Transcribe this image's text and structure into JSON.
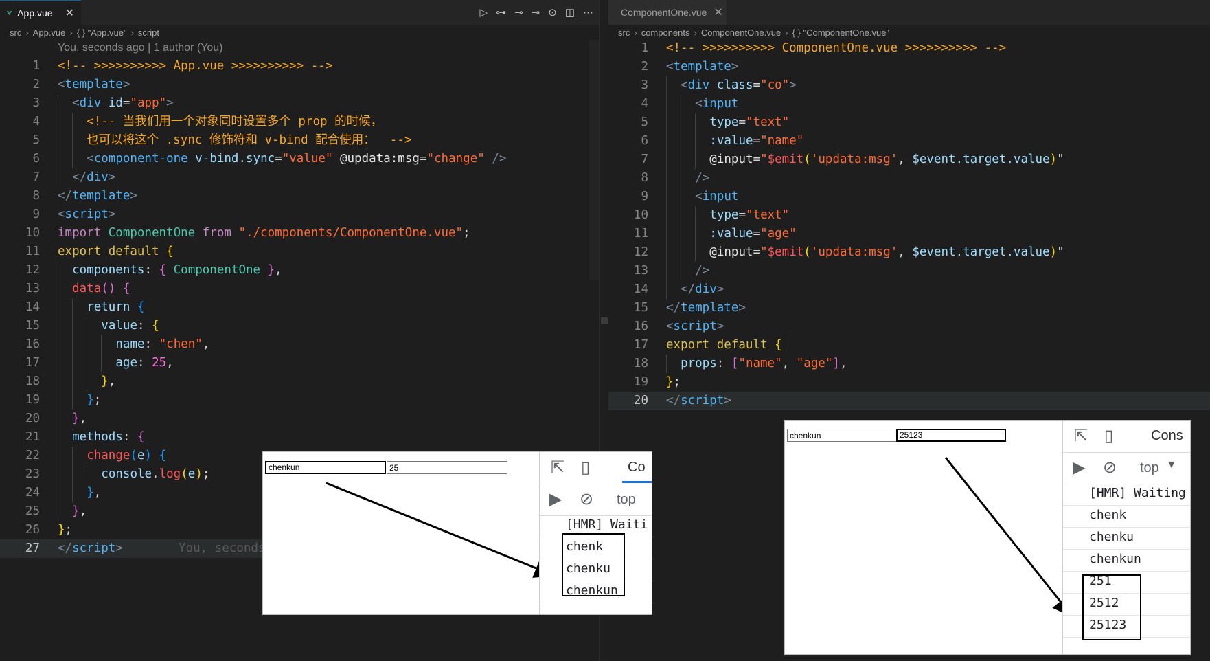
{
  "left_editor": {
    "tab": {
      "title": "App.vue"
    },
    "breadcrumb": [
      "src",
      "App.vue",
      "{ } \"App.vue\"",
      "script"
    ],
    "codelens": "You, seconds ago | 1 author (You)",
    "ghost_blame": "You, seconds",
    "current_line": 27,
    "lines": [
      {
        "n": 1,
        "g": 0,
        "tokens": [
          [
            "com",
            "<!-- >>>>>>>>>> App.vue >>>>>>>>>> -->"
          ]
        ]
      },
      {
        "n": 2,
        "g": 0,
        "tokens": [
          [
            "br",
            "<"
          ],
          [
            "tag",
            "template"
          ],
          [
            "br",
            ">"
          ]
        ]
      },
      {
        "n": 3,
        "g": 1,
        "tokens": [
          [
            "br",
            "<"
          ],
          [
            "tag",
            "div"
          ],
          [
            "plain",
            " "
          ],
          [
            "attr",
            "id"
          ],
          [
            "plain",
            "="
          ],
          [
            "str",
            "\"app\""
          ],
          [
            "br",
            ">"
          ]
        ]
      },
      {
        "n": 4,
        "g": 2,
        "tokens": [
          [
            "com",
            "<!-- 当我们用一个对象同时设置多个 prop 的时候，"
          ]
        ]
      },
      {
        "n": 5,
        "g": 2,
        "tokens": [
          [
            "com",
            "也可以将这个 .sync 修饰符和 v-bind 配合使用：  -->"
          ]
        ]
      },
      {
        "n": 6,
        "g": 2,
        "tokens": [
          [
            "br",
            "<"
          ],
          [
            "tag",
            "component-one"
          ],
          [
            "plain",
            " "
          ],
          [
            "attr",
            "v-bind.sync"
          ],
          [
            "plain",
            "="
          ],
          [
            "str",
            "\"value\""
          ],
          [
            "plain",
            " "
          ],
          [
            "ev",
            "@updata:msg"
          ],
          [
            "plain",
            "="
          ],
          [
            "str",
            "\"change\""
          ],
          [
            "plain",
            " "
          ],
          [
            "br",
            "/>"
          ]
        ]
      },
      {
        "n": 7,
        "g": 1,
        "tokens": [
          [
            "br",
            "</"
          ],
          [
            "tag",
            "div"
          ],
          [
            "br",
            ">"
          ]
        ]
      },
      {
        "n": 8,
        "g": 0,
        "tokens": [
          [
            "br",
            "</"
          ],
          [
            "tag",
            "template"
          ],
          [
            "br",
            ">"
          ]
        ]
      },
      {
        "n": 9,
        "g": 0,
        "tokens": [
          [
            "br",
            "<"
          ],
          [
            "tag",
            "script"
          ],
          [
            "br",
            ">"
          ]
        ]
      },
      {
        "n": 10,
        "g": 0,
        "tokens": [
          [
            "import",
            "import"
          ],
          [
            "plain",
            " "
          ],
          [
            "cls",
            "ComponentOne"
          ],
          [
            "plain",
            " "
          ],
          [
            "import",
            "from"
          ],
          [
            "plain",
            " "
          ],
          [
            "str",
            "\"./components/ComponentOne.vue\""
          ],
          [
            "plain",
            ";"
          ]
        ]
      },
      {
        "n": 11,
        "g": 0,
        "tokens": [
          [
            "def",
            "export default"
          ],
          [
            "plain",
            " "
          ],
          [
            "p1",
            "{"
          ]
        ]
      },
      {
        "n": 12,
        "g": 1,
        "tokens": [
          [
            "key",
            "components"
          ],
          [
            "plain",
            ": "
          ],
          [
            "p2",
            "{"
          ],
          [
            "plain",
            " "
          ],
          [
            "cls",
            "ComponentOne"
          ],
          [
            "plain",
            " "
          ],
          [
            "p2",
            "}"
          ],
          [
            "plain",
            ","
          ]
        ]
      },
      {
        "n": 13,
        "g": 1,
        "tokens": [
          [
            "emit",
            "data"
          ],
          [
            "p2",
            "()"
          ],
          [
            "plain",
            " "
          ],
          [
            "p2",
            "{"
          ]
        ]
      },
      {
        "n": 14,
        "g": 2,
        "tokens": [
          [
            "key",
            "return"
          ],
          [
            "plain",
            " "
          ],
          [
            "p3",
            "{"
          ]
        ]
      },
      {
        "n": 15,
        "g": 3,
        "tokens": [
          [
            "key",
            "value"
          ],
          [
            "plain",
            ": "
          ],
          [
            "p1",
            "{"
          ]
        ]
      },
      {
        "n": 16,
        "g": 4,
        "tokens": [
          [
            "key",
            "name"
          ],
          [
            "plain",
            ": "
          ],
          [
            "str",
            "\"chen\""
          ],
          [
            "plain",
            ","
          ]
        ]
      },
      {
        "n": 17,
        "g": 4,
        "tokens": [
          [
            "key",
            "age"
          ],
          [
            "plain",
            ": "
          ],
          [
            "num",
            "25"
          ],
          [
            "plain",
            ","
          ]
        ]
      },
      {
        "n": 18,
        "g": 3,
        "tokens": [
          [
            "p1",
            "}"
          ],
          [
            "plain",
            ","
          ]
        ]
      },
      {
        "n": 19,
        "g": 2,
        "tokens": [
          [
            "p3",
            "}"
          ],
          [
            "plain",
            ";"
          ]
        ]
      },
      {
        "n": 20,
        "g": 1,
        "tokens": [
          [
            "p2",
            "}"
          ],
          [
            "plain",
            ","
          ]
        ]
      },
      {
        "n": 21,
        "g": 1,
        "tokens": [
          [
            "key",
            "methods"
          ],
          [
            "plain",
            ": "
          ],
          [
            "p2",
            "{"
          ]
        ]
      },
      {
        "n": 22,
        "g": 2,
        "tokens": [
          [
            "emit",
            "change"
          ],
          [
            "p3",
            "("
          ],
          [
            "var",
            "e"
          ],
          [
            "p3",
            ")"
          ],
          [
            "plain",
            " "
          ],
          [
            "p3",
            "{"
          ]
        ]
      },
      {
        "n": 23,
        "g": 3,
        "tokens": [
          [
            "var",
            "console"
          ],
          [
            "plain",
            "."
          ],
          [
            "emit",
            "log"
          ],
          [
            "p1",
            "("
          ],
          [
            "var",
            "e"
          ],
          [
            "p1",
            ")"
          ],
          [
            "plain",
            ";"
          ]
        ]
      },
      {
        "n": 24,
        "g": 2,
        "tokens": [
          [
            "p3",
            "}"
          ],
          [
            "plain",
            ","
          ]
        ]
      },
      {
        "n": 25,
        "g": 1,
        "tokens": [
          [
            "p2",
            "}"
          ],
          [
            "plain",
            ","
          ]
        ]
      },
      {
        "n": 26,
        "g": 0,
        "tokens": [
          [
            "p1",
            "}"
          ],
          [
            "plain",
            ";"
          ]
        ]
      },
      {
        "n": 27,
        "g": 0,
        "tokens": [
          [
            "br",
            "</"
          ],
          [
            "tag",
            "script"
          ],
          [
            "br",
            ">"
          ]
        ]
      }
    ]
  },
  "right_editor": {
    "tab": {
      "title": "ComponentOne.vue"
    },
    "breadcrumb": [
      "src",
      "components",
      "ComponentOne.vue",
      "{ } \"ComponentOne.vue\""
    ],
    "current_line": 20,
    "lines": [
      {
        "n": 1,
        "g": 0,
        "tokens": [
          [
            "com",
            "<!-- >>>>>>>>>> ComponentOne.vue >>>>>>>>>> -->"
          ]
        ]
      },
      {
        "n": 2,
        "g": 0,
        "tokens": [
          [
            "br",
            "<"
          ],
          [
            "tag",
            "template"
          ],
          [
            "br",
            ">"
          ]
        ]
      },
      {
        "n": 3,
        "g": 1,
        "tokens": [
          [
            "br",
            "<"
          ],
          [
            "tag",
            "div"
          ],
          [
            "plain",
            " "
          ],
          [
            "attr",
            "class"
          ],
          [
            "plain",
            "="
          ],
          [
            "str",
            "\"co\""
          ],
          [
            "br",
            ">"
          ]
        ]
      },
      {
        "n": 4,
        "g": 2,
        "tokens": [
          [
            "br",
            "<"
          ],
          [
            "tag",
            "input"
          ]
        ]
      },
      {
        "n": 5,
        "g": 3,
        "tokens": [
          [
            "attr",
            "type"
          ],
          [
            "plain",
            "="
          ],
          [
            "str",
            "\"text\""
          ]
        ]
      },
      {
        "n": 6,
        "g": 3,
        "tokens": [
          [
            "attr",
            ":value"
          ],
          [
            "plain",
            "="
          ],
          [
            "str",
            "\"name\""
          ]
        ]
      },
      {
        "n": 7,
        "g": 3,
        "tokens": [
          [
            "ev",
            "@input"
          ],
          [
            "plain",
            "="
          ],
          [
            "str",
            "\""
          ],
          [
            "emit",
            "$emit"
          ],
          [
            "p1",
            "("
          ],
          [
            "str",
            "'updata:msg'"
          ],
          [
            "plain",
            ", "
          ],
          [
            "var",
            "$event.target.value"
          ],
          [
            "p1",
            ")"
          ],
          [
            "plain",
            "\""
          ]
        ]
      },
      {
        "n": 8,
        "g": 2,
        "tokens": [
          [
            "br",
            "/>"
          ]
        ]
      },
      {
        "n": 9,
        "g": 2,
        "tokens": [
          [
            "br",
            "<"
          ],
          [
            "tag",
            "input"
          ]
        ]
      },
      {
        "n": 10,
        "g": 3,
        "tokens": [
          [
            "attr",
            "type"
          ],
          [
            "plain",
            "="
          ],
          [
            "str",
            "\"text\""
          ]
        ]
      },
      {
        "n": 11,
        "g": 3,
        "tokens": [
          [
            "attr",
            ":value"
          ],
          [
            "plain",
            "="
          ],
          [
            "str",
            "\"age\""
          ]
        ]
      },
      {
        "n": 12,
        "g": 3,
        "tokens": [
          [
            "ev",
            "@input"
          ],
          [
            "plain",
            "="
          ],
          [
            "str",
            "\""
          ],
          [
            "emit",
            "$emit"
          ],
          [
            "p1",
            "("
          ],
          [
            "str",
            "'updata:msg'"
          ],
          [
            "plain",
            ", "
          ],
          [
            "var",
            "$event.target.value"
          ],
          [
            "p1",
            ")"
          ],
          [
            "plain",
            "\""
          ]
        ]
      },
      {
        "n": 13,
        "g": 2,
        "tokens": [
          [
            "br",
            "/>"
          ]
        ]
      },
      {
        "n": 14,
        "g": 1,
        "tokens": [
          [
            "br",
            "</"
          ],
          [
            "tag",
            "div"
          ],
          [
            "br",
            ">"
          ]
        ]
      },
      {
        "n": 15,
        "g": 0,
        "tokens": [
          [
            "br",
            "</"
          ],
          [
            "tag",
            "template"
          ],
          [
            "br",
            ">"
          ]
        ]
      },
      {
        "n": 16,
        "g": 0,
        "tokens": [
          [
            "br",
            "<"
          ],
          [
            "tag",
            "script"
          ],
          [
            "br",
            ">"
          ]
        ]
      },
      {
        "n": 17,
        "g": 0,
        "tokens": [
          [
            "def",
            "export default"
          ],
          [
            "plain",
            " "
          ],
          [
            "p1",
            "{"
          ]
        ]
      },
      {
        "n": 18,
        "g": 1,
        "tokens": [
          [
            "key",
            "props"
          ],
          [
            "plain",
            ": "
          ],
          [
            "p2",
            "["
          ],
          [
            "str",
            "\"name\""
          ],
          [
            "plain",
            ", "
          ],
          [
            "str",
            "\"age\""
          ],
          [
            "p2",
            "]"
          ],
          [
            "plain",
            ","
          ]
        ]
      },
      {
        "n": 19,
        "g": 0,
        "tokens": [
          [
            "p1",
            "}"
          ],
          [
            "plain",
            ";"
          ]
        ]
      },
      {
        "n": 20,
        "g": 0,
        "tokens": [
          [
            "br",
            "</"
          ],
          [
            "tag",
            "script"
          ],
          [
            "br",
            ">"
          ]
        ]
      }
    ]
  },
  "shot_left": {
    "name_input": "chenkun",
    "age_input": "25",
    "devtools_tab": "Co",
    "context": "top",
    "console": [
      "[HMR] Waiti",
      "chenk",
      "chenku",
      "chenkun"
    ]
  },
  "shot_right": {
    "name_input": "chenkun",
    "age_input": "25123",
    "devtools_tab": "Cons",
    "context": "top",
    "console": [
      "[HMR] Waiting",
      "chenk",
      "chenku",
      "chenkun",
      "251",
      "2512",
      "25123"
    ]
  },
  "colors": {
    "editor_bg": "#1e1e1e",
    "tab_bar": "#252526",
    "accent": "#0e639c",
    "vue_green": "#41b883"
  }
}
